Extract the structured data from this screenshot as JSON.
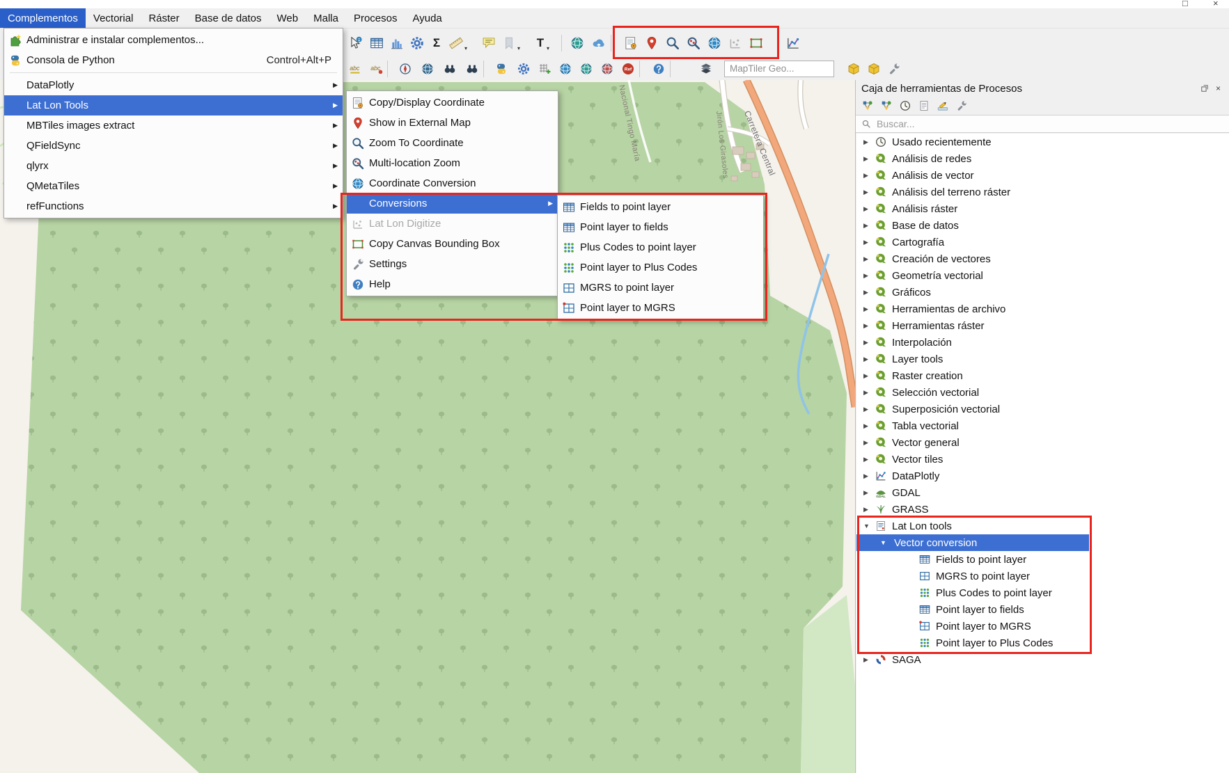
{
  "glyphs": {
    "arrow_right": "▶",
    "arrow_down": "▼",
    "caret_down": "▾",
    "close": "×",
    "maximize": "□",
    "sigma": "Σ",
    "T": "T",
    "abc": "abc",
    "ref": "Ref",
    "gdal": "GDAL"
  },
  "menubar": {
    "items": [
      {
        "label": "Complementos",
        "active": true
      },
      {
        "label": "Vectorial"
      },
      {
        "label": "Ráster"
      },
      {
        "label": "Base de datos"
      },
      {
        "label": "Web"
      },
      {
        "label": "Malla"
      },
      {
        "label": "Procesos"
      },
      {
        "label": "Ayuda"
      }
    ]
  },
  "plugins_menu": {
    "items": [
      {
        "label": "Administrar e instalar complementos...",
        "icon": "plugin-manager-icon"
      },
      {
        "label": "Consola de Python",
        "shortcut": "Control+Alt+P",
        "icon": "python-console-icon"
      },
      {
        "label": "DataPlotly",
        "submenu": true
      },
      {
        "label": "Lat Lon Tools",
        "submenu": true,
        "highlighted": true
      },
      {
        "label": "MBTiles images extract",
        "submenu": true
      },
      {
        "label": "QFieldSync",
        "submenu": true
      },
      {
        "label": "qlyrx",
        "submenu": true
      },
      {
        "label": "QMetaTiles",
        "submenu": true
      },
      {
        "label": "refFunctions",
        "submenu": true
      }
    ]
  },
  "latlon_menu": {
    "items": [
      {
        "label": "Copy/Display Coordinate",
        "icon": "copy-coordinate-icon"
      },
      {
        "label": "Show in External Map",
        "icon": "external-map-pin-icon"
      },
      {
        "label": "Zoom To Coordinate",
        "icon": "zoom-to-coordinate-icon"
      },
      {
        "label": "Multi-location Zoom",
        "icon": "multi-location-zoom-icon"
      },
      {
        "label": "Coordinate Conversion",
        "icon": "coordinate-conversion-globe-icon"
      },
      {
        "label": "Conversions",
        "submenu": true,
        "highlighted": true
      },
      {
        "label": "Lat Lon Digitize",
        "icon": "latlon-digitize-icon",
        "disabled": true
      },
      {
        "label": "Copy Canvas Bounding Box",
        "icon": "bounding-box-icon"
      },
      {
        "label": "Settings",
        "icon": "settings-wrench-icon"
      },
      {
        "label": "Help",
        "icon": "help-icon"
      }
    ]
  },
  "conversions_menu": {
    "items": [
      {
        "label": "Fields to point layer",
        "icon": "table-icon"
      },
      {
        "label": "Point layer to fields",
        "icon": "table-icon"
      },
      {
        "label": "Plus Codes to point layer",
        "icon": "plus-codes-icon"
      },
      {
        "label": "Point layer to Plus Codes",
        "icon": "plus-codes-icon"
      },
      {
        "label": "MGRS to point layer",
        "icon": "mgrs-grid-icon"
      },
      {
        "label": "Point layer to MGRS",
        "icon": "mgrs-grid-red-icon"
      }
    ]
  },
  "toolbar_main": {
    "icons": [
      "identify-features-icon",
      "attribute-table-icon",
      "histogram-icon",
      "processing-toolbox-icon",
      "statistics-icon",
      "measure-icon",
      "map-tips-icon",
      "bookmarks-icon",
      "text-annotation-icon",
      "web-globe-icon",
      "cloud-upload-icon",
      "copy-coordinate-icon",
      "external-map-pin-icon",
      "zoom-to-coordinate-icon",
      "multi-location-zoom-icon",
      "coordinate-conversion-icon",
      "latlon-digitize-icon",
      "canvas-bounding-box-icon",
      "dataplotly-icon"
    ]
  },
  "toolbar_second": {
    "maptiler_placeholder": "MapTiler Geo...",
    "icons": [
      "labeling-icon",
      "label-pin-icon",
      "azimuth-icon",
      "dark-globe-icon",
      "binoculars-icon",
      "binoculars-plus-icon",
      "python-console-icon",
      "processing-gear-icon",
      "add-grid-icon",
      "globe-blue-icon",
      "globe-teal-icon",
      "globe-red-icon",
      "ref-functions-icon",
      "help-icon",
      "layers-icon",
      "geopackage-cube-icon",
      "geopackage-cube-icon",
      "settings-wrench-icon"
    ]
  },
  "toolbox": {
    "title": "Caja de herramientas de Procesos",
    "titlebar_icons": [
      "float-panel-icon",
      "close-panel-icon"
    ],
    "toolbar_icons": [
      "models-icon",
      "workflow-icon",
      "history-icon",
      "results-log-icon",
      "edit-features-icon",
      "options-wrench-icon"
    ],
    "search": {
      "placeholder": "Buscar...",
      "icon": "search-icon"
    },
    "groups": [
      {
        "label": "Usado recientemente",
        "icon": "recent-clock-icon"
      },
      {
        "label": "Análisis de redes",
        "icon": "qgis-provider-icon"
      },
      {
        "label": "Análisis de vector",
        "icon": "qgis-provider-icon"
      },
      {
        "label": "Análisis del terreno ráster",
        "icon": "qgis-provider-icon"
      },
      {
        "label": "Análisis ráster",
        "icon": "qgis-provider-icon"
      },
      {
        "label": "Base de datos",
        "icon": "qgis-provider-icon"
      },
      {
        "label": "Cartografía",
        "icon": "qgis-provider-icon"
      },
      {
        "label": "Creación de vectores",
        "icon": "qgis-provider-icon"
      },
      {
        "label": "Geometría vectorial",
        "icon": "qgis-provider-icon"
      },
      {
        "label": "Gráficos",
        "icon": "qgis-provider-icon"
      },
      {
        "label": "Herramientas de archivo",
        "icon": "qgis-provider-icon"
      },
      {
        "label": "Herramientas ráster",
        "icon": "qgis-provider-icon"
      },
      {
        "label": "Interpolación",
        "icon": "qgis-provider-icon"
      },
      {
        "label": "Layer tools",
        "icon": "qgis-provider-icon"
      },
      {
        "label": "Raster creation",
        "icon": "qgis-provider-icon"
      },
      {
        "label": "Selección vectorial",
        "icon": "qgis-provider-icon"
      },
      {
        "label": "Superposición vectorial",
        "icon": "qgis-provider-icon"
      },
      {
        "label": "Tabla vectorial",
        "icon": "qgis-provider-icon"
      },
      {
        "label": "Vector general",
        "icon": "qgis-provider-icon"
      },
      {
        "label": "Vector tiles",
        "icon": "qgis-provider-icon"
      },
      {
        "label": "DataPlotly",
        "icon": "dataplotly-chart-icon"
      },
      {
        "label": "GDAL",
        "icon": "gdal-icon"
      },
      {
        "label": "GRASS",
        "icon": "grass-icon"
      }
    ],
    "latlon": {
      "label": "Lat Lon tools",
      "icon": "latlon-notebook-icon",
      "subgroup": {
        "label": "Vector conversion",
        "selected": true,
        "children": [
          {
            "label": "Fields to point layer",
            "icon": "table-icon"
          },
          {
            "label": "MGRS to point layer",
            "icon": "mgrs-grid-icon"
          },
          {
            "label": "Plus Codes to point layer",
            "icon": "plus-codes-icon"
          },
          {
            "label": "Point layer to fields",
            "icon": "table-icon"
          },
          {
            "label": "Point layer to MGRS",
            "icon": "mgrs-grid-red-icon"
          },
          {
            "label": "Point layer to Plus Codes",
            "icon": "plus-codes-icon"
          }
        ]
      }
    },
    "saga": {
      "label": "SAGA",
      "icon": "saga-icon"
    }
  },
  "map": {
    "road_labels": [
      {
        "text": "Nacional Tingo María"
      },
      {
        "text": "Jirón Los Girasoles"
      },
      {
        "text": "Carretera Central"
      }
    ]
  },
  "colors": {
    "annotation_red": "#e8241d",
    "selection_blue": "#3d6fd2",
    "menubar_active_blue": "#2a5fc9",
    "forest_fill": "#b7d4a4",
    "forest_symbol": "#9cbb8a"
  }
}
